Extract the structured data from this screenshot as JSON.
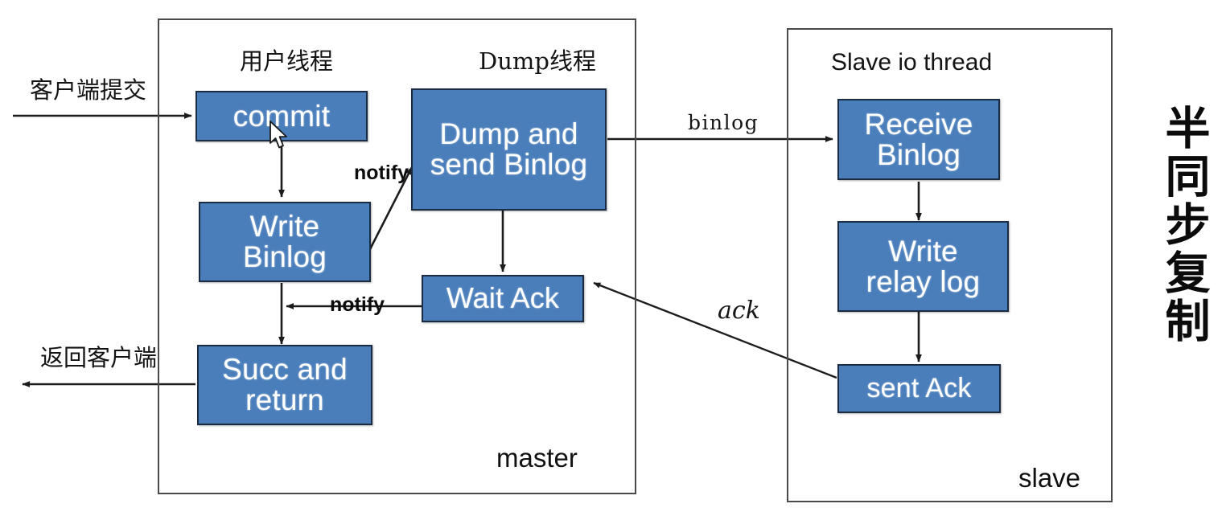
{
  "diagram": {
    "title_vertical": "半同步复制",
    "containers": [
      {
        "id": "master",
        "label": "master"
      },
      {
        "id": "slave",
        "label": "slave"
      }
    ],
    "thread_labels": {
      "user_thread": "用户线程",
      "dump_thread": "Dump线程",
      "slave_io_thread": "Slave io thread"
    },
    "boxes": {
      "commit": "commit",
      "write_binlog_line1": "Write",
      "write_binlog_line2": "Binlog",
      "succ_return_line1": "Succ and",
      "succ_return_line2": "return",
      "dump_send_line1": "Dump and",
      "dump_send_line2": "send Binlog",
      "wait_ack": "Wait Ack",
      "receive_binlog_line1": "Receive",
      "receive_binlog_line2": "Binlog",
      "write_relay_line1": "Write",
      "write_relay_line2": "relay log",
      "sent_ack": "sent Ack"
    },
    "edge_labels": {
      "client_commit": "客户端提交",
      "return_client": "返回客户端",
      "notify_dump": "notify",
      "notify_succ": "notify",
      "binlog": "binlog",
      "ack": "ack"
    },
    "colors": {
      "box_fill": "#4a7ebb",
      "box_border": "#1a2b43",
      "frame_border": "#4a4a4a",
      "arrow": "#1c1c1c",
      "text_dark": "#111111",
      "text_light": "#ffffff",
      "background": "#ffffff"
    }
  }
}
